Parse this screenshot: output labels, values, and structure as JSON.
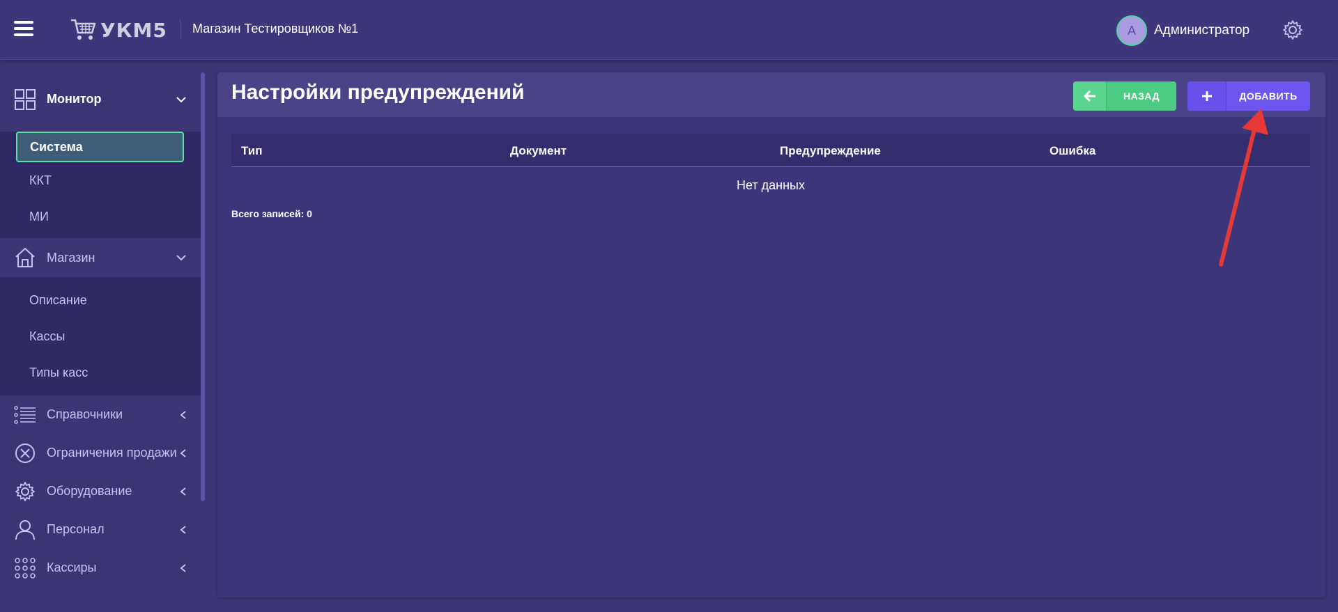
{
  "header": {
    "logo_text": "УКМ5",
    "store_name": "Магазин Тестировщиков №1",
    "avatar_letter": "А",
    "user_name": "Администратор"
  },
  "sidebar": {
    "monitor": {
      "label": "Монитор",
      "items": [
        "Система",
        "ККТ",
        "МИ"
      ]
    },
    "store": {
      "label": "Магазин",
      "items": [
        "Описание",
        "Кассы",
        "Типы касс"
      ]
    },
    "sections": [
      {
        "label": "Справочники",
        "icon": "list-icon"
      },
      {
        "label": "Ограничения продажи",
        "icon": "circle-x-icon"
      },
      {
        "label": "Оборудование",
        "icon": "gear-icon"
      },
      {
        "label": "Персонал",
        "icon": "person-icon"
      },
      {
        "label": "Кассиры",
        "icon": "grid-dots-icon"
      }
    ]
  },
  "page": {
    "title": "Настройки предупреждений",
    "back_label": "НАЗАД",
    "add_label": "ДОБАВИТЬ",
    "columns": [
      "Тип",
      "Документ",
      "Предупреждение",
      "Ошибка"
    ],
    "empty_text": "Нет данных",
    "total_label": "Всего записей: 0"
  },
  "colors": {
    "background": "#3b3576",
    "accent_green": "#4ccb82",
    "accent_purple": "#6f55ef",
    "arrow_red": "#e53935"
  }
}
